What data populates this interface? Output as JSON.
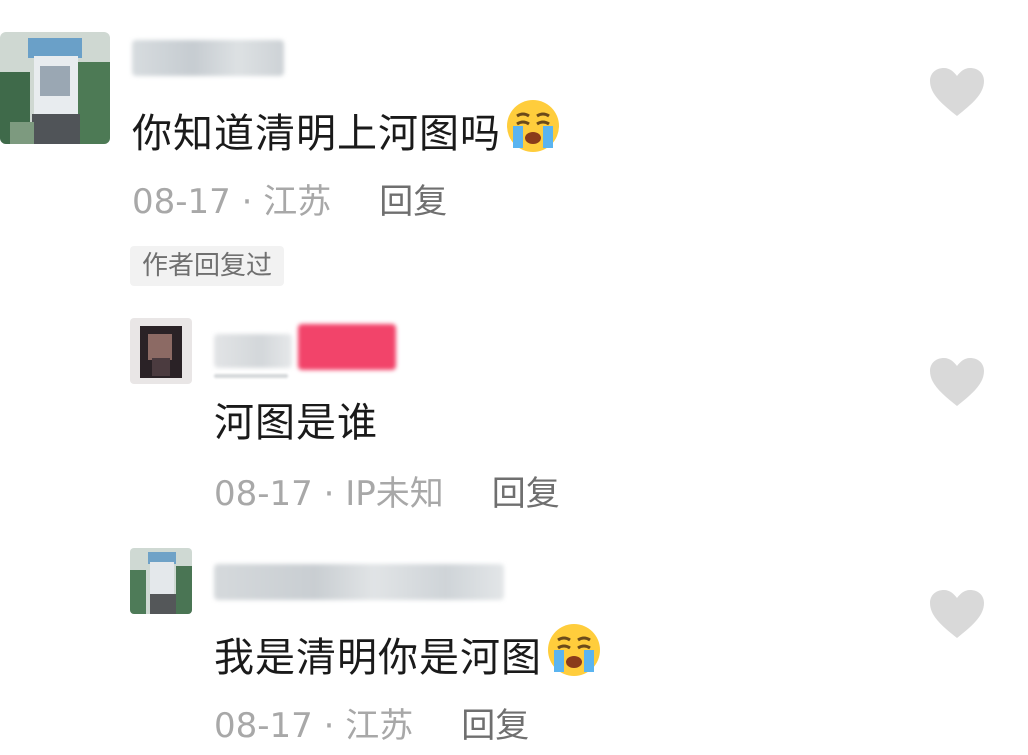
{
  "comments": [
    {
      "text": "你知道清明上河图吗",
      "emoji": "loudly-crying-face",
      "date": "08-17",
      "location": "江苏",
      "reply_label": "回复",
      "badge": "作者回复过",
      "like_icon": "heart-icon"
    },
    {
      "text": "河图是谁",
      "date": "08-17",
      "location": "IP未知",
      "reply_label": "回复",
      "like_icon": "heart-icon"
    },
    {
      "text": "我是清明你是河图",
      "emoji": "loudly-crying-face",
      "date": "08-17",
      "location": "江苏",
      "reply_label": "回复",
      "like_icon": "heart-icon"
    }
  ],
  "meta_separator": " · ",
  "colors": {
    "text": "#1a1a1a",
    "meta": "#a8a8a8",
    "reply": "#6f6f6f",
    "heart": "#d9d9d9",
    "badge_bg": "#f2f2f2",
    "author_tag": "#f2446a"
  }
}
